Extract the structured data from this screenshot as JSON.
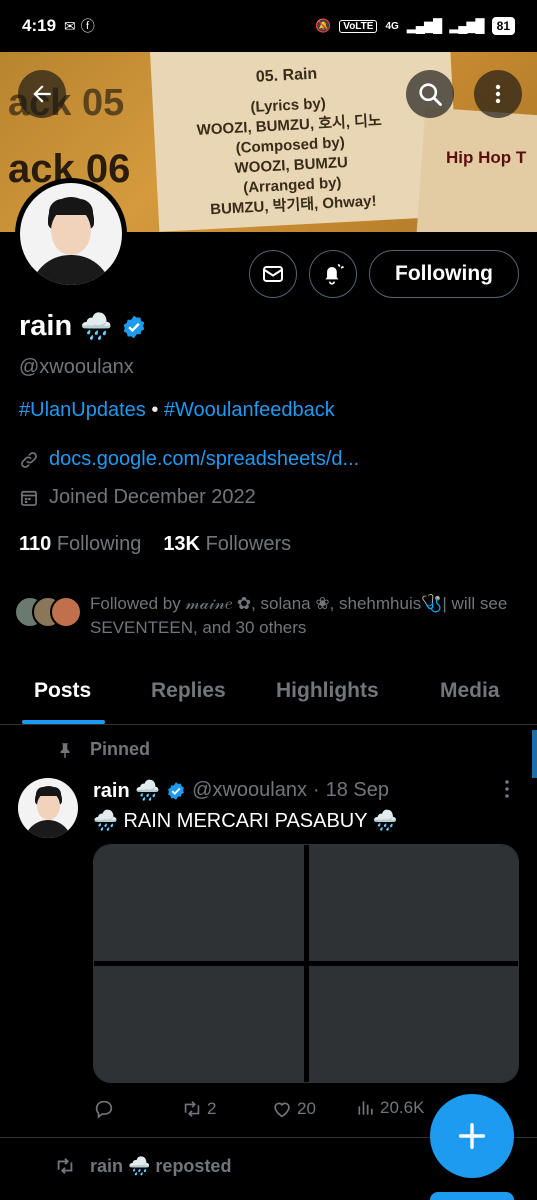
{
  "status_bar": {
    "time": "4:19",
    "volte": "VoLTE",
    "net": "4G",
    "battery": "81"
  },
  "banner": {
    "bg_text_top": "ack 05",
    "bg_text_main": "ack 06",
    "track_title": "05. Rain",
    "credits": [
      "(Lyrics by)",
      "WOOZI, BUMZU, 호시, 디노",
      "(Composed by)",
      "WOOZI, BUMZU",
      "(Arranged by)",
      "BUMZU, 박기태, Ohway!"
    ],
    "side_text": "Hip Hop T"
  },
  "profile": {
    "name": "rain",
    "name_emoji": "🌧️",
    "handle": "@xwooulanx",
    "bio_tag1": "#UlanUpdates",
    "bio_sep": "•",
    "bio_tag2": "#Wooulanfeedback",
    "link": "docs.google.com/spreadsheets/d...",
    "joined": "Joined December 2022",
    "following_count": "110",
    "following_label": "Following",
    "followers_count": "13K",
    "followers_label": "Followers",
    "followed_by": "Followed by 𝓂𝒶𝒾𝓃𝑒 ✿, solana ❀, shehmhuis🩺| will see SEVENTEEN, and 30 others",
    "following_button": "Following"
  },
  "tabs": [
    "Posts",
    "Replies",
    "Highlights",
    "Media"
  ],
  "pinned_tweet": {
    "pinned_label": "Pinned",
    "author": "rain 🌧️",
    "handle": "@xwooulanx",
    "sep": "·",
    "date": "18 Sep",
    "text": "🌧️ RAIN MERCARI PASABUY 🌧️",
    "reposts": "2",
    "likes": "20",
    "views": "20.6K"
  },
  "next_item": {
    "label": "rain 🌧️ reposted"
  },
  "colors": {
    "accent": "#1d9bf0",
    "muted": "#71767b",
    "background": "#000000"
  },
  "icons": [
    "back-arrow-icon",
    "search-icon",
    "more-vertical-icon",
    "mail-icon",
    "bell-plus-icon",
    "verified-badge-icon",
    "link-icon",
    "calendar-icon",
    "pin-icon",
    "reply-icon",
    "retweet-icon",
    "heart-icon",
    "views-icon",
    "plus-icon"
  ]
}
